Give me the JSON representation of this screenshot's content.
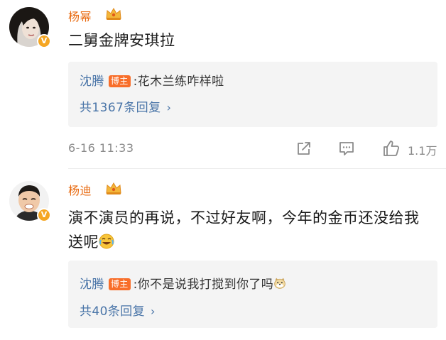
{
  "comments": [
    {
      "username": "杨幂",
      "text": "二舅金牌安琪拉",
      "reply": {
        "author": "沈腾",
        "tag": "博主",
        "separator": ":",
        "text": "花木兰练咋样啦"
      },
      "more_replies": "共1367条回复",
      "timestamp": "6-16 11:33",
      "like_count": "1.1万"
    },
    {
      "username": "杨迪",
      "text": "演不演员的再说，不过好友啊，今年的金币还没给我送呢",
      "text_emoji": "laughing-tears-emoji",
      "reply": {
        "author": "沈腾",
        "tag": "博主",
        "separator": ":",
        "text": "你不是说我打搅到你了吗",
        "emoji": "doge-emoji"
      },
      "more_replies": "共40条回复"
    }
  ],
  "icons": {
    "verified_badge": "v-badge-icon",
    "crown": "crown-icon",
    "chevron": "›",
    "share": "share-icon",
    "comment": "comment-icon",
    "like": "like-icon"
  },
  "colors": {
    "username": "#e86a10",
    "reply_author": "#4a75a8",
    "blogger_tag": "#f86e2a",
    "reply_bg": "#f4f4f4",
    "meta_gray": "#8a8a8a",
    "verified_badge": "#f5a623"
  }
}
